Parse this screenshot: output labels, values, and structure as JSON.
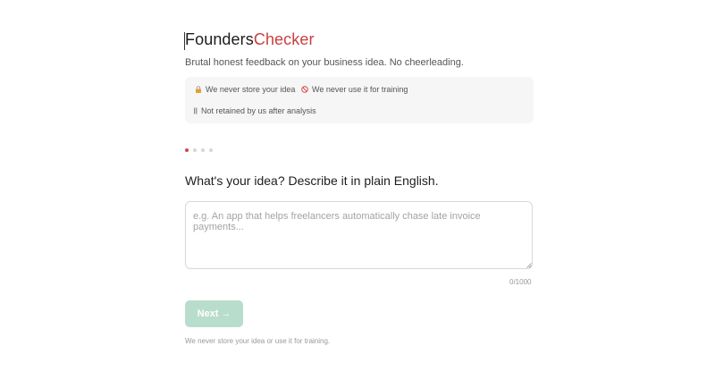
{
  "brand": {
    "part1": "Founders",
    "part2": "Checker"
  },
  "tagline": "Brutal honest feedback on your business idea. No cheerleading.",
  "privacy": {
    "items": [
      {
        "icon": "lock-icon",
        "label": "We never store your idea"
      },
      {
        "icon": "prohibited-icon",
        "label": "We never use it for training"
      },
      {
        "icon": "bars-icon",
        "label": "Not retained by us after analysis"
      }
    ]
  },
  "stepper": {
    "total": 4,
    "current": 1
  },
  "question": "What's your idea? Describe it in plain English.",
  "idea_input": {
    "value": "",
    "placeholder": "e.g. An app that helps freelancers automatically chase late invoice payments...",
    "counter": "0/1000"
  },
  "next_button": {
    "label": "Next",
    "arrow": "→"
  },
  "footer": "We never store your idea or use it for training.",
  "colors": {
    "accent": "#c94040",
    "button_disabled": "#b9ddcc",
    "panel": "#f6f6f6"
  }
}
